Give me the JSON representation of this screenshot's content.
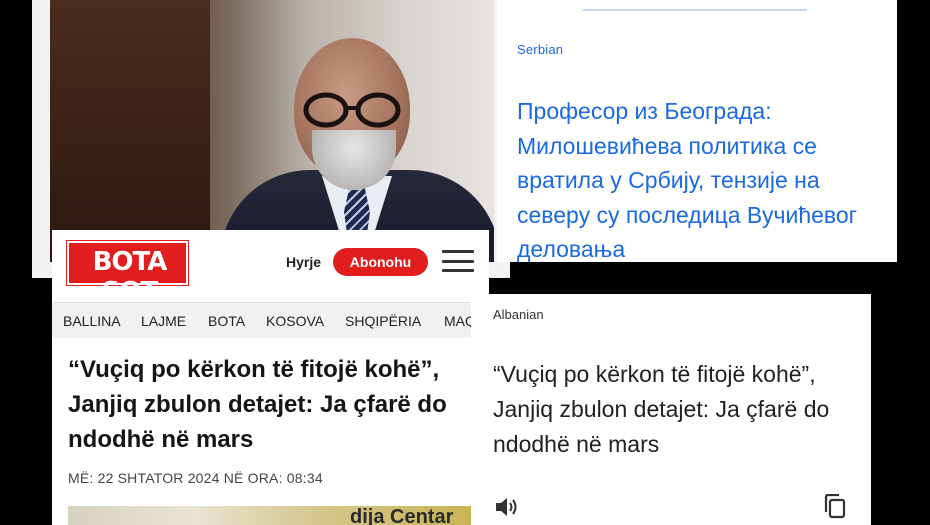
{
  "serbian_card": {
    "language": "Serbian",
    "text": "Професор из Београда: Милошевићева политика се вратила у Србију, тензије на северу су последица Вучићевог деловања"
  },
  "botasot": {
    "logo": "BOTA SOT",
    "login_label": "Hyrje",
    "subscribe_label": "Abonohu",
    "nav": [
      "BALLINA",
      "LAJME",
      "BOTA",
      "KOSOVA",
      "SHQIPËRIA",
      "MAQ"
    ],
    "headline": "“Vuçiq po kërkon të fitojë kohë”, Janjiq zbulon detajet: Ja çfarë do ndodhë në mars",
    "date": "MË: 22 SHTATOR 2024 NË ORA: 08:34",
    "image_caption_fragment": "dija Centar"
  },
  "albanian_card": {
    "language": "Albanian",
    "text": "“Vuçiq po kërkon të fitojë kohë”, Janjiq zbulon detajet: Ja çfarë do ndodhë në mars"
  },
  "colors": {
    "link_blue": "#1a6ae0",
    "brand_red": "#e21d1d"
  },
  "icons": [
    "speaker-icon",
    "copy-icon",
    "hamburger-menu-icon"
  ]
}
